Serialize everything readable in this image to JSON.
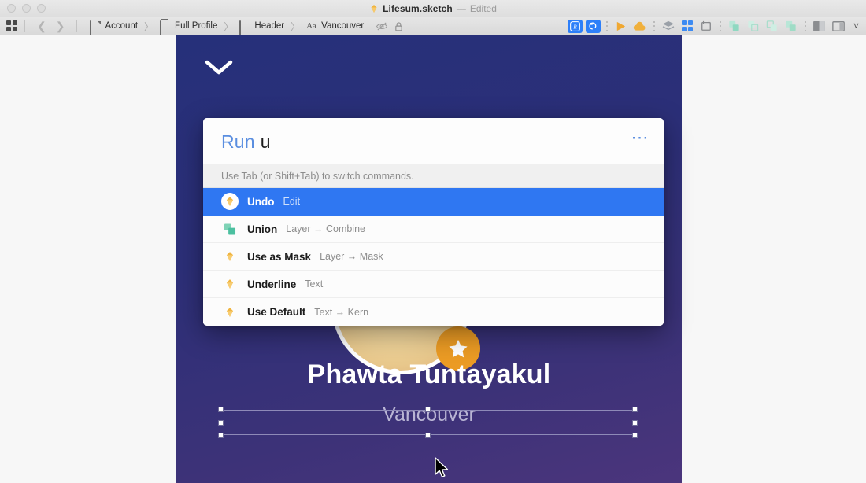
{
  "window": {
    "title": "Lifesum.sketch",
    "separator": "—",
    "edited_label": "Edited",
    "app_icon": "sketch-diamond-icon",
    "traffic_lights": [
      "close",
      "minimize",
      "zoom"
    ]
  },
  "toolbar": {
    "grid_icon": "grid-view-icon",
    "nav_back_icon": "chevron-left-icon",
    "nav_forward_icon": "chevron-right-icon",
    "breadcrumb": [
      {
        "icon": "page-icon",
        "label": "Account"
      },
      {
        "icon": "artboard-icon",
        "label": "Full Profile"
      },
      {
        "icon": "group-icon",
        "label": "Header"
      },
      {
        "icon": "text-aa-icon",
        "label": "Vancouver"
      }
    ],
    "breadcrumb_separator": "〉",
    "layer_state_icons": [
      "eye-slash-hidden-icon",
      "lock-icon"
    ],
    "right_items": [
      {
        "name": "runner-plugin-button",
        "style": "blue",
        "glyph": "R"
      },
      {
        "name": "undo-rotate-button",
        "style": "blue",
        "glyph": "↺"
      },
      {
        "name": "toolbar-separator-dots",
        "style": "dots"
      },
      {
        "name": "preview-play-button",
        "style": "orange-play"
      },
      {
        "name": "cloud-upload-button",
        "style": "orange-cloud"
      },
      {
        "name": "toolbar-separator-dots",
        "style": "dots"
      },
      {
        "name": "layers-stack-button",
        "style": "gray-layers"
      },
      {
        "name": "grid-arrange-button",
        "style": "blue-grid"
      },
      {
        "name": "artboard-insert-button",
        "style": "gray-artboard"
      },
      {
        "name": "toolbar-separator-dots",
        "style": "dots"
      },
      {
        "name": "boolean-union-button",
        "style": "faded-teal"
      },
      {
        "name": "boolean-subtract-button",
        "style": "faded-teal"
      },
      {
        "name": "boolean-intersect-button",
        "style": "faded-teal"
      },
      {
        "name": "boolean-difference-button",
        "style": "faded-teal"
      },
      {
        "name": "toolbar-separator-dots",
        "style": "dots"
      },
      {
        "name": "mask-button",
        "style": "gray-mask"
      },
      {
        "name": "inspector-toggle-button",
        "style": "gray-panel"
      }
    ],
    "overflow_icon": "chevron-down-icon"
  },
  "palette": {
    "query_token": "Run",
    "query_text": "u",
    "more_icon": "ellipsis-icon",
    "hint": "Use Tab (or Shift+Tab) to switch commands.",
    "results": [
      {
        "title": "Undo",
        "path": "Edit",
        "icon": "sketch-diamond-icon",
        "selected": true
      },
      {
        "title": "Union",
        "path": "Layer → Combine",
        "icon": "boolean-union-icon",
        "selected": false
      },
      {
        "title": "Use as Mask",
        "path": "Layer → Mask",
        "icon": "sketch-diamond-icon",
        "selected": false
      },
      {
        "title": "Underline",
        "path": "Text",
        "icon": "sketch-diamond-icon",
        "selected": false
      },
      {
        "title": "Use Default",
        "path": "Text → Kern",
        "icon": "sketch-diamond-icon",
        "selected": false
      }
    ]
  },
  "canvas": {
    "chevron_icon": "chevron-down-shape",
    "avatar_name": "profile-photo",
    "badge_icon": "star-icon",
    "profile_name": "Phawta Tuntayakul",
    "profile_city": "Vancouver",
    "cursor_icon": "arrow-cursor"
  },
  "colors": {
    "accent_blue": "#2f77f2",
    "query_token_blue": "#5a8ee0",
    "artboard_top": "#26307a",
    "artboard_bottom": "#4b357c",
    "badge_orange": "#eb9b24",
    "sketch_gold": "#f0b541",
    "boolean_teal": "#4cc0a0",
    "city_text": "#b9b5d4"
  }
}
